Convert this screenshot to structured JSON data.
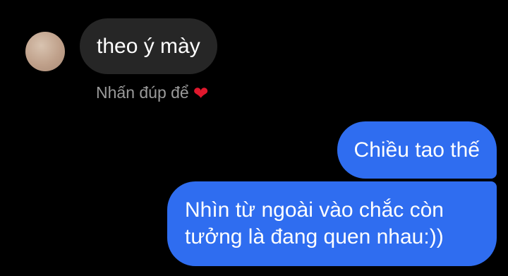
{
  "conversation": {
    "incoming": {
      "text": "theo ý mày",
      "reaction_hint": "Nhấn đúp để",
      "reaction_icon": "heart-icon",
      "reaction_glyph": "❤"
    },
    "outgoing": [
      {
        "lines": [
          "Chiều tao thế"
        ]
      },
      {
        "lines": [
          "Nhìn từ ngoài vào chắc còn",
          "tưởng là đang quen nhau:))"
        ]
      }
    ]
  },
  "colors": {
    "background": "#000000",
    "incoming_bubble": "#262626",
    "outgoing_bubble": "#2f6df0",
    "hint_text": "#9a9a9a",
    "heart": "#e0182d"
  }
}
